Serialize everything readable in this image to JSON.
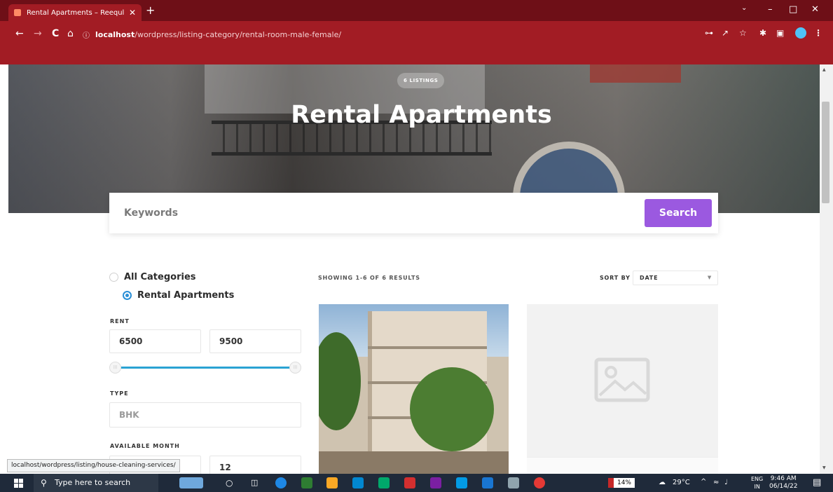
{
  "browser": {
    "tab_title": "Rental Apartments – Reequle",
    "tab_close": "✕",
    "new_tab": "+",
    "url_host": "localhost",
    "url_path": "/wordpress/listing-category/rental-room-male-female/",
    "window_minimize": "–",
    "window_restore": "□",
    "window_close": "✕",
    "back": "←",
    "forward": "→",
    "reload": "C",
    "home": "⌂",
    "icons": [
      "key-icon",
      "share-icon",
      "star-icon",
      "extensions-icon",
      "sidepanel-icon",
      "profile-icon",
      "menu-icon"
    ]
  },
  "hero": {
    "badge": "6 LISTINGS",
    "title": "Rental Apartments"
  },
  "search": {
    "placeholder": "Keywords",
    "button": "Search"
  },
  "filters": {
    "categories": [
      {
        "label": "All Categories",
        "checked": false
      },
      {
        "label": "Rental Apartments",
        "checked": true
      }
    ],
    "rent_label": "RENT",
    "rent_min": "6500",
    "rent_max": "9500",
    "type_label": "TYPE",
    "type_placeholder": "BHK",
    "month_label": "AVAILABLE MONTH",
    "month_max": "12"
  },
  "results": {
    "count_text": "SHOWING 1-6 OF 6 RESULTS",
    "sort_label": "SORT BY",
    "sort_value": "DATE"
  },
  "status_url": "localhost/wordpress/listing/house-cleaning-services/",
  "taskbar": {
    "search_placeholder": "Type here to search",
    "battery": "14%",
    "weather": "29°C",
    "lang_line1": "ENG",
    "lang_line2": "IN",
    "time": "9:46 AM",
    "date": "06/14/22"
  },
  "colors": {
    "browser_frame": "#a21c24",
    "tab_strip": "#6e0f17",
    "search_button": "#9b59e0",
    "slider": "#2aa3d3",
    "radio_selected": "#2b8fd6"
  }
}
